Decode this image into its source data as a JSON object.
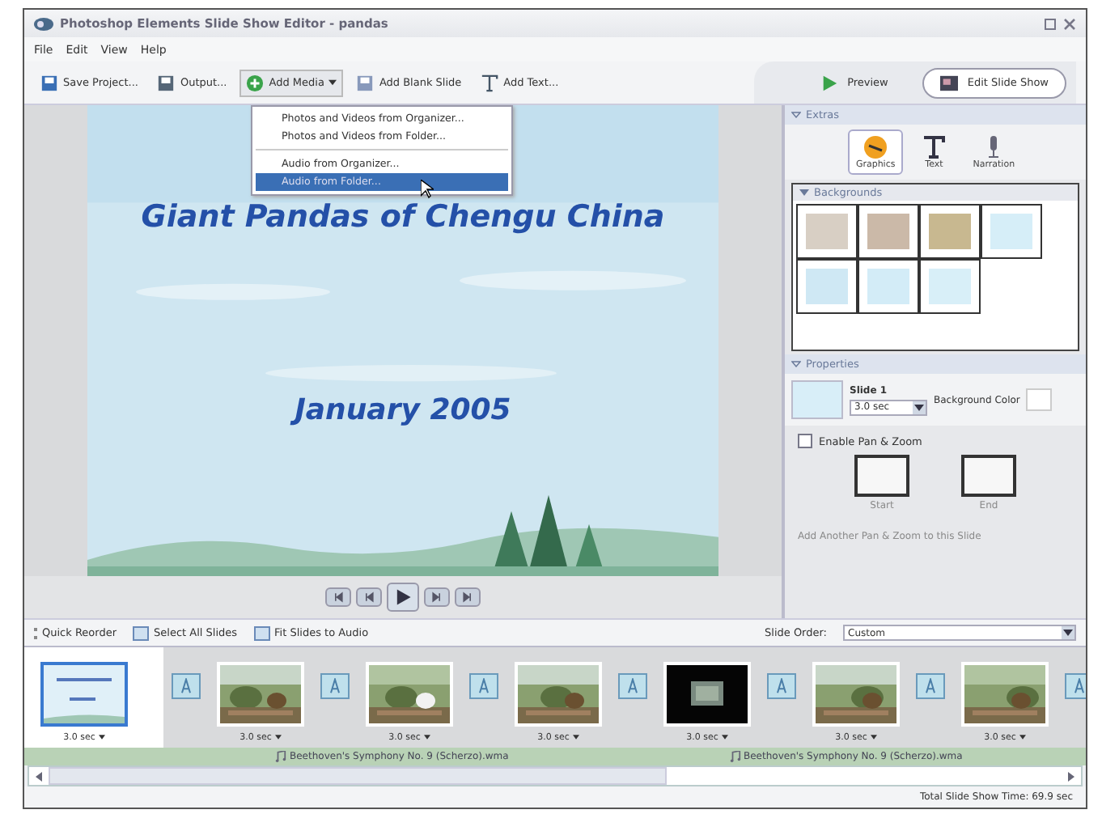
{
  "window": {
    "title": "Photoshop Elements Slide Show Editor - pandas"
  },
  "menu": [
    "File",
    "Edit",
    "View",
    "Help"
  ],
  "toolbar": [
    {
      "label": "Save Project...",
      "dropdown": false
    },
    {
      "label": "Output...",
      "dropdown": false
    },
    {
      "label": "Add Media",
      "dropdown": true
    },
    {
      "label": "Add Blank Slide",
      "dropdown": false
    },
    {
      "label": "Add Text...",
      "dropdown": false
    }
  ],
  "mode_buttons": [
    {
      "label": "Preview",
      "selected": false
    },
    {
      "label": "Edit Slide Show",
      "selected": true
    }
  ],
  "add_media_menu": [
    {
      "label": "Photos and Videos from Organizer...",
      "selected": false,
      "separator_after": false
    },
    {
      "label": "Photos and Videos from Folder...",
      "selected": false,
      "separator_after": true
    },
    {
      "label": "Audio from Organizer...",
      "selected": false,
      "separator_after": false
    },
    {
      "label": "Audio from Folder...",
      "selected": true,
      "separator_after": false
    }
  ],
  "slide": {
    "title": "Giant Pandas of Chengu China",
    "subtitle": "January 2005"
  },
  "extras": {
    "title": "Extras",
    "tabs": [
      {
        "label": "Graphics",
        "selected": true
      },
      {
        "label": "Text",
        "selected": false
      },
      {
        "label": "Narration",
        "selected": false
      }
    ],
    "section": "Backgrounds",
    "backgrounds": [
      {
        "color": "#d8cfc4"
      },
      {
        "color": "#cbb9a8"
      },
      {
        "color": "#c8b890"
      },
      {
        "color": "#d6eef8"
      },
      {
        "color": "#cfe8f4"
      },
      {
        "color": "#d3ecf7"
      },
      {
        "color": "#d8eff8"
      }
    ]
  },
  "properties": {
    "title": "Properties",
    "slide_name": "Slide 1",
    "duration": "3.0 sec",
    "background_label": "Background Color",
    "pan_zoom": {
      "label": "Enable Pan & Zoom",
      "checked": false
    },
    "start": "Start",
    "end": "End",
    "add_pan_zoom": {
      "label": "Add Another Pan & Zoom to this Slide",
      "disabled": true
    }
  },
  "storyboard": {
    "tools": [
      "Quick Reorder",
      "Select All Slides",
      "Fit Slides to Audio"
    ],
    "order_label": "Slide Order:",
    "order_value": "Custom",
    "slides": [
      {
        "kind": "title",
        "duration": "3.0 sec",
        "selected": true
      },
      {
        "kind": "picture",
        "duration": "3.0 sec",
        "selected": false
      },
      {
        "kind": "picture",
        "duration": "3.0 sec",
        "selected": false
      },
      {
        "kind": "picture",
        "duration": "3.0 sec",
        "selected": false
      },
      {
        "kind": "dark",
        "duration": "3.0 sec",
        "selected": false
      },
      {
        "kind": "picture",
        "duration": "3.0 sec",
        "selected": false
      },
      {
        "kind": "picture",
        "duration": "3.0 sec",
        "selected": false
      }
    ],
    "audio": [
      "Beethoven's Symphony No. 9 (Scherzo).wma",
      "Beethoven's Symphony No. 9 (Scherzo).wma"
    ]
  },
  "status_bar": "Total Slide Show Time: 69.9 sec"
}
